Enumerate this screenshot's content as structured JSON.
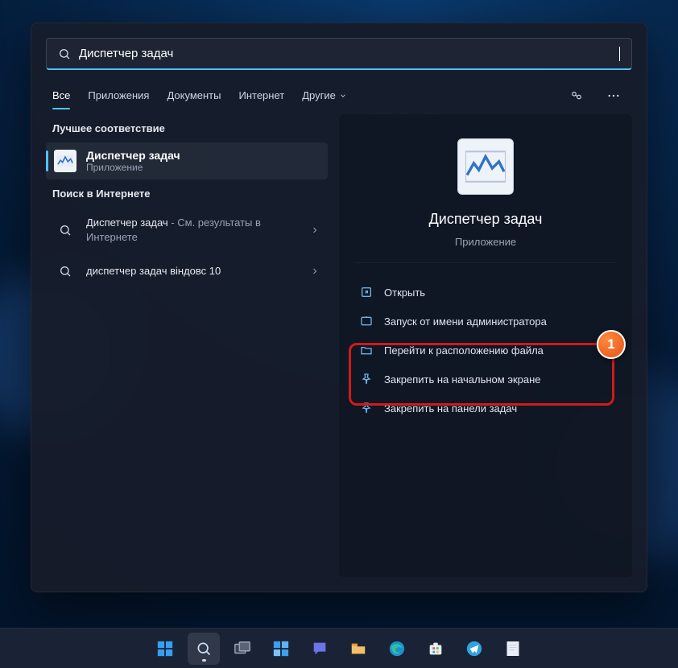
{
  "search": {
    "query": "Диспетчер задач"
  },
  "tabs": {
    "all": "Все",
    "apps": "Приложения",
    "docs": "Документы",
    "web": "Интернет",
    "more": "Другие"
  },
  "left": {
    "best_match_header": "Лучшее соответствие",
    "best_match": {
      "title": "Диспетчер задач",
      "subtitle": "Приложение"
    },
    "web_header": "Поиск в Интернете",
    "web1_a": "Диспетчер задач",
    "web1_b": " - См. результаты в Интернете",
    "web2": "диспетчер задач віндовс 10"
  },
  "right": {
    "app_name": "Диспетчер задач",
    "app_type": "Приложение",
    "actions": {
      "open": "Открыть",
      "admin": "Запуск от имени администратора",
      "loc": "Перейти к расположению файла",
      "pin_start": "Закрепить на начальном экране",
      "pin_taskbar": "Закрепить на панели задач"
    }
  },
  "annotation": {
    "number": "1"
  }
}
